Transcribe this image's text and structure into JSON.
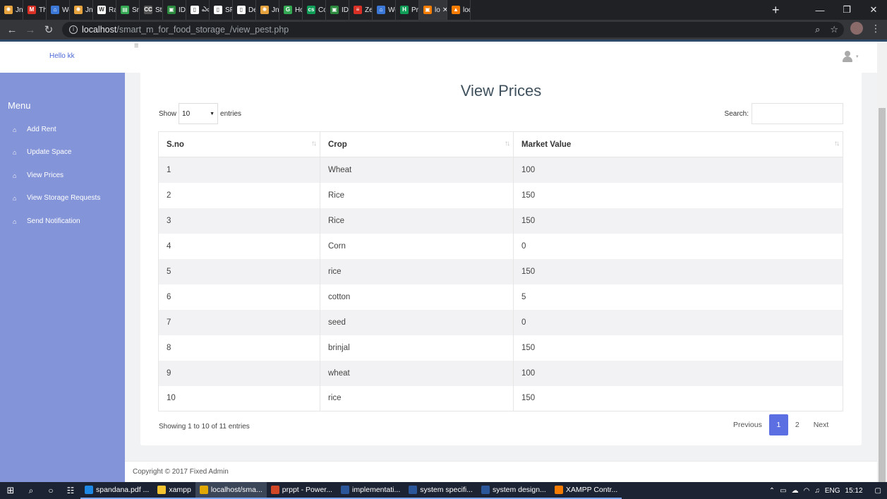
{
  "browser": {
    "tabs": [
      {
        "label": "Jnan",
        "color": "#e6a23c",
        "glyph": "✺"
      },
      {
        "label": "Than",
        "color": "#d93025",
        "glyph": "M"
      },
      {
        "label": "Worl",
        "color": "#3c78d8",
        "glyph": "⌂"
      },
      {
        "label": "Jnan",
        "color": "#e6a23c",
        "glyph": "✺"
      },
      {
        "label": "Ram",
        "color": "#ffffff",
        "glyph": "W"
      },
      {
        "label": "Sree",
        "color": "#34a853",
        "glyph": "▤"
      },
      {
        "label": "Strar",
        "color": "#555555",
        "glyph": "CC"
      },
      {
        "label": "IDE |",
        "color": "#2b8a3e",
        "glyph": "▣"
      },
      {
        "label": "ఎం",
        "color": "#ffffff",
        "glyph": "▯"
      },
      {
        "label": "SPAI",
        "color": "#ffffff",
        "glyph": "▯"
      },
      {
        "label": "Dep",
        "color": "#ffffff",
        "glyph": "▯"
      },
      {
        "label": "Jnan",
        "color": "#e6a23c",
        "glyph": "✺"
      },
      {
        "label": "How",
        "color": "#34a853",
        "glyph": "G"
      },
      {
        "label": "Cour",
        "color": "#0f9d58",
        "glyph": "cs"
      },
      {
        "label": "IDE |",
        "color": "#2b8a3e",
        "glyph": "▣"
      },
      {
        "label": "Zenc",
        "color": "#d93025",
        "glyph": "≡"
      },
      {
        "label": "Worl",
        "color": "#3c78d8",
        "glyph": "⌂"
      },
      {
        "label": "Prati",
        "color": "#0f9d58",
        "glyph": "H"
      },
      {
        "label": "lo",
        "color": "#f57c00",
        "glyph": "▣"
      },
      {
        "label": "local",
        "color": "#f57c00",
        "glyph": "▲"
      }
    ],
    "active_tab_index": 18,
    "new_tab": "+",
    "url_host": "localhost",
    "url_path": "/smart_m_for_food_storage_/view_pest.php"
  },
  "header": {
    "greeting": "Hello kk"
  },
  "sidebar": {
    "title": "Menu",
    "items": [
      {
        "label": "Add Rent"
      },
      {
        "label": "Update Space"
      },
      {
        "label": "View Prices"
      },
      {
        "label": "View Storage Requests"
      },
      {
        "label": "Send Notification"
      }
    ]
  },
  "main": {
    "title": "View Prices",
    "show_label": "Show",
    "entries_value": "10",
    "entries_label": "entries",
    "search_label": "Search:",
    "columns": [
      "S.no",
      "Crop",
      "Market Value"
    ],
    "rows": [
      [
        "1",
        "Wheat",
        "100"
      ],
      [
        "2",
        "Rice",
        "150"
      ],
      [
        "3",
        "Rice",
        "150"
      ],
      [
        "4",
        "Corn",
        "0"
      ],
      [
        "5",
        "rice",
        "150"
      ],
      [
        "6",
        "cotton",
        "5"
      ],
      [
        "7",
        "seed",
        "0"
      ],
      [
        "8",
        "brinjal",
        "150"
      ],
      [
        "9",
        "wheat",
        "100"
      ],
      [
        "10",
        "rice",
        "150"
      ]
    ],
    "info": "Showing 1 to 10 of 11 entries",
    "pagination": {
      "previous": "Previous",
      "pages": [
        "1",
        "2"
      ],
      "current": "1",
      "next": "Next"
    }
  },
  "footer": {
    "text": "Copyright © 2017 Fixed Admin"
  },
  "taskbar": {
    "apps": [
      {
        "label": "spandana.pdf ...",
        "color": "#1e88e5",
        "state": "open"
      },
      {
        "label": "xampp",
        "color": "#f4c430",
        "state": "open"
      },
      {
        "label": "localhost/sma...",
        "color": "#e0a800",
        "state": "active"
      },
      {
        "label": "prppt - Power...",
        "color": "#d24726",
        "state": "open"
      },
      {
        "label": "implementati...",
        "color": "#2b579a",
        "state": "open"
      },
      {
        "label": "system specifi...",
        "color": "#2b579a",
        "state": "open"
      },
      {
        "label": "system design...",
        "color": "#2b579a",
        "state": "open"
      },
      {
        "label": "XAMPP Contr...",
        "color": "#f57c00",
        "state": "open"
      }
    ],
    "language": "ENG",
    "time": "15:12"
  },
  "colors": {
    "sidebar": "#8394d8",
    "accent": "#5b6fe3",
    "greeting": "#4a67d6"
  }
}
